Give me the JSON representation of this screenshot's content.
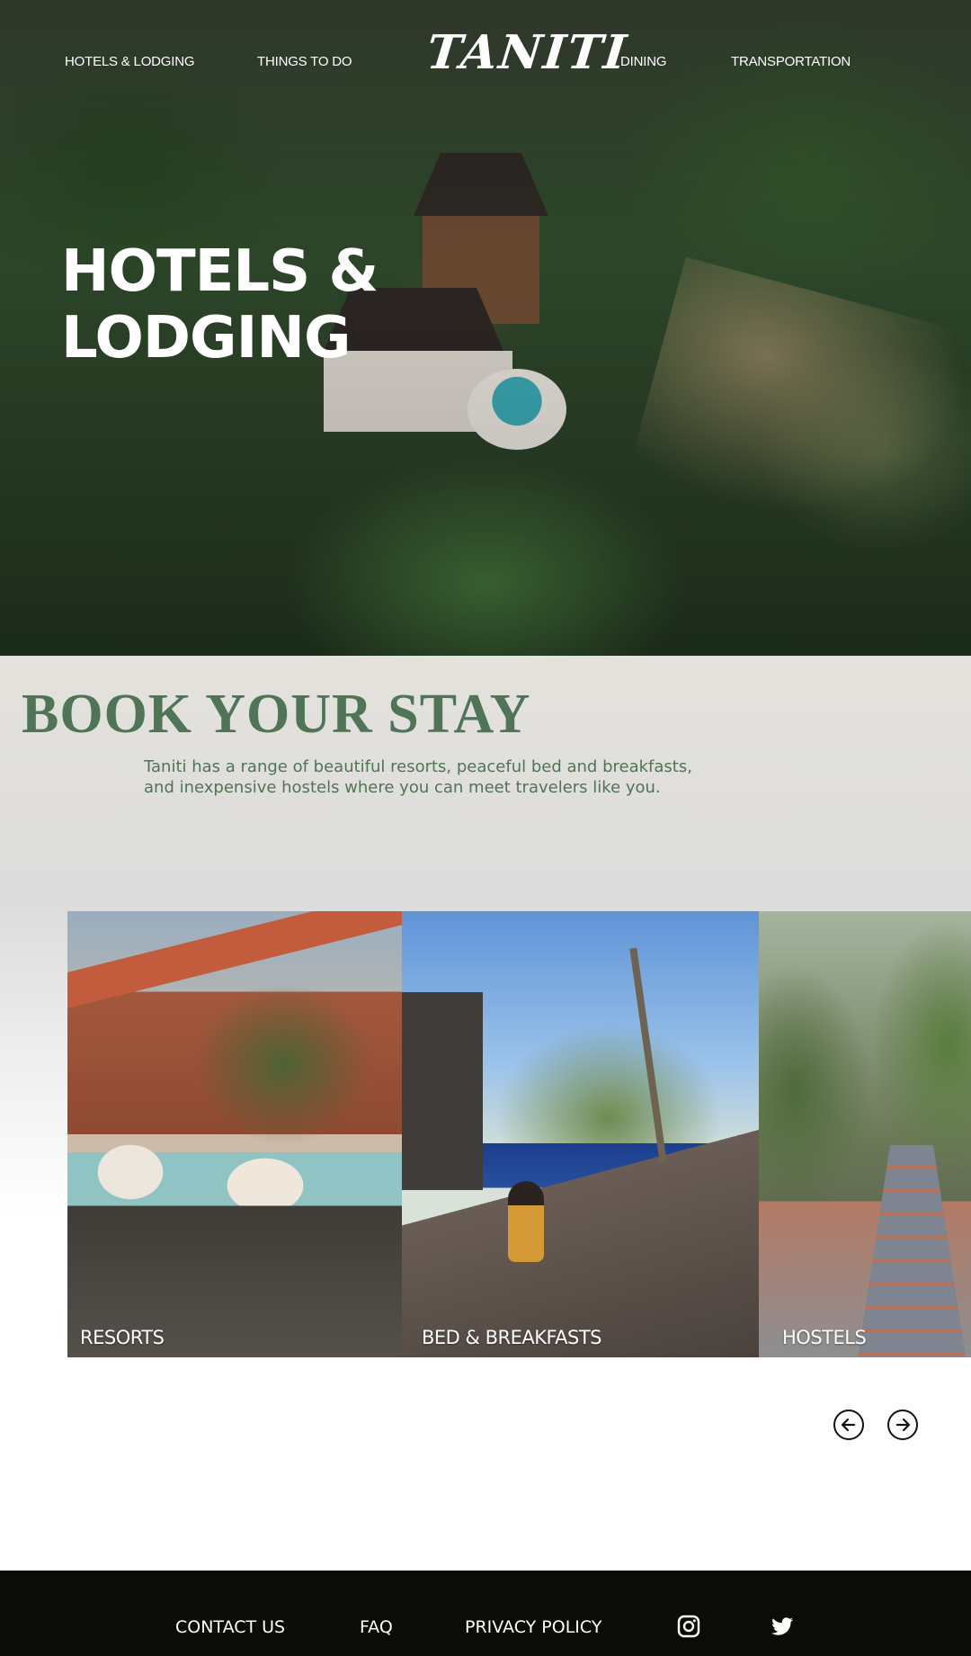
{
  "nav": {
    "left_links": [
      "HOTELS & LODGING",
      "THINGS TO DO"
    ],
    "logo": "TANITI",
    "right_links": [
      "DINING",
      "TRANSPORTATION"
    ]
  },
  "hero": {
    "title_line1": "HOTELS &",
    "title_line2": "LODGING"
  },
  "book": {
    "title": "BOOK YOUR STAY",
    "description_line1": "Taniti has a range of beautiful resorts, peaceful bed and breakfasts,",
    "description_line2": "and inexpensive hostels where you can meet travelers like you."
  },
  "carousel": {
    "cards": [
      {
        "label": "RESORTS"
      },
      {
        "label": "BED & BREAKFASTS"
      },
      {
        "label": "HOSTELS"
      }
    ],
    "prev_icon": "arrow-left-circle-icon",
    "next_icon": "arrow-right-circle-icon"
  },
  "footer": {
    "links": [
      "CONTACT US",
      "FAQ",
      "PRIVACY POLICY"
    ],
    "icons": [
      "instagram-icon",
      "twitter-icon"
    ]
  },
  "colors": {
    "accent_green": "#4f7456",
    "footer_bg": "#0b0b07",
    "section_bg": "#e4e2dc"
  }
}
